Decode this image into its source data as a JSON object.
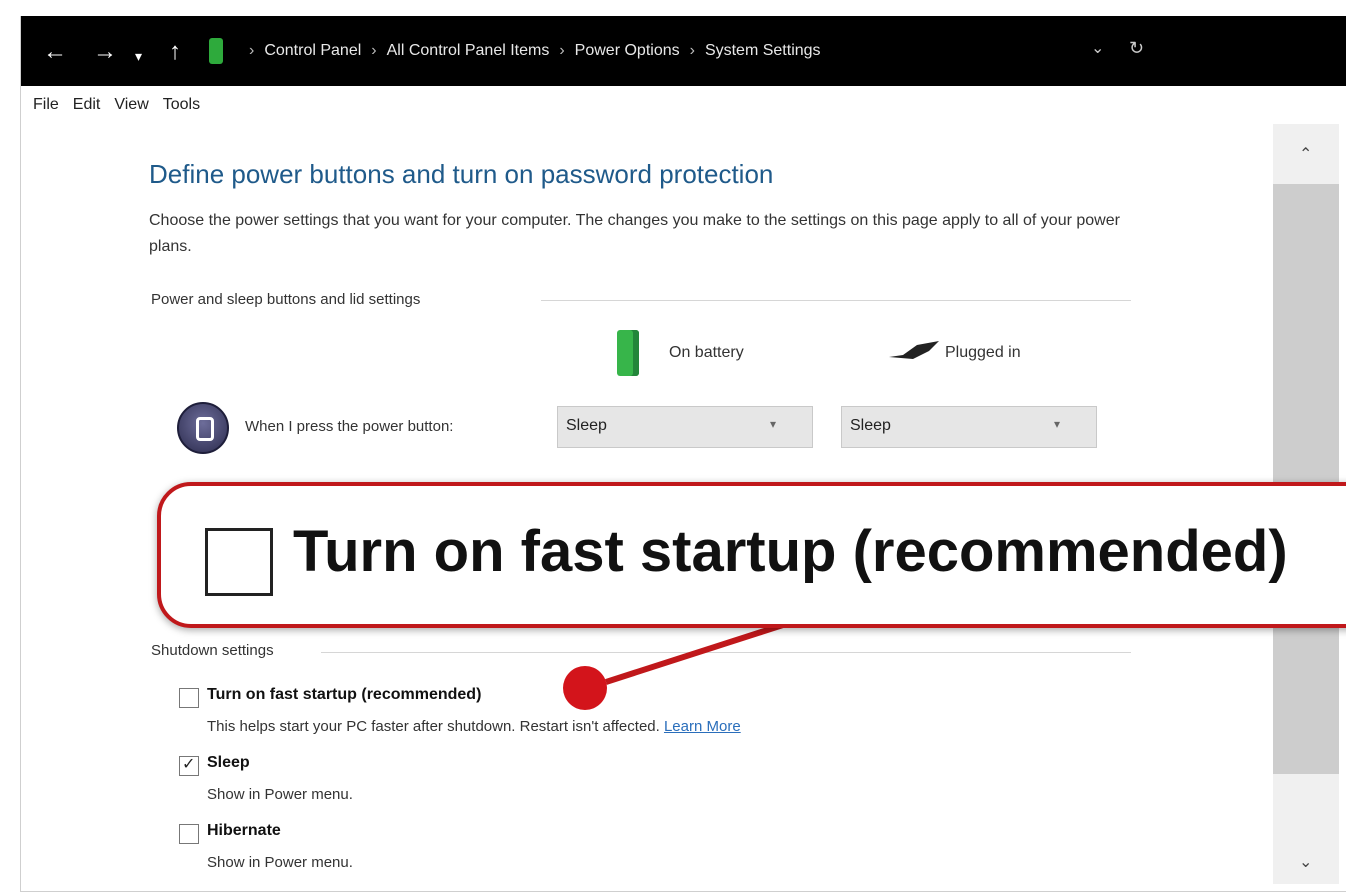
{
  "address_bar": {
    "breadcrumbs": [
      "Control Panel",
      "All Control Panel Items",
      "Power Options",
      "System Settings"
    ],
    "separator": "›"
  },
  "menu": [
    "File",
    "Edit",
    "View",
    "Tools"
  ],
  "page": {
    "title": "Define power buttons and turn on password protection",
    "description": "Choose the power settings that you want for your computer. The changes you make to the settings on this page apply to all of your power plans.",
    "section_buttons": "Power and sleep buttons and lid settings",
    "col_battery": "On battery",
    "col_plugged": "Plugged in",
    "power_button_label": "When I press the power button:",
    "power_on_battery": "Sleep",
    "power_plugged_in": "Sleep"
  },
  "callout": {
    "text": "Turn on fast startup (recommended)"
  },
  "shutdown": {
    "title": "Shutdown settings",
    "fast_startup": {
      "label": "Turn on fast startup (recommended)",
      "checked": false,
      "sub": "This helps start your PC faster after shutdown. Restart isn't affected.",
      "link": "Learn More"
    },
    "sleep": {
      "label": "Sleep",
      "checked": true,
      "sub": "Show in Power menu."
    },
    "hibernate": {
      "label": "Hibernate",
      "checked": false,
      "sub": "Show in Power menu."
    }
  },
  "colors": {
    "callout_red": "#c0181b",
    "title_blue": "#1f5a8a",
    "battery_green": "#37b54a"
  }
}
